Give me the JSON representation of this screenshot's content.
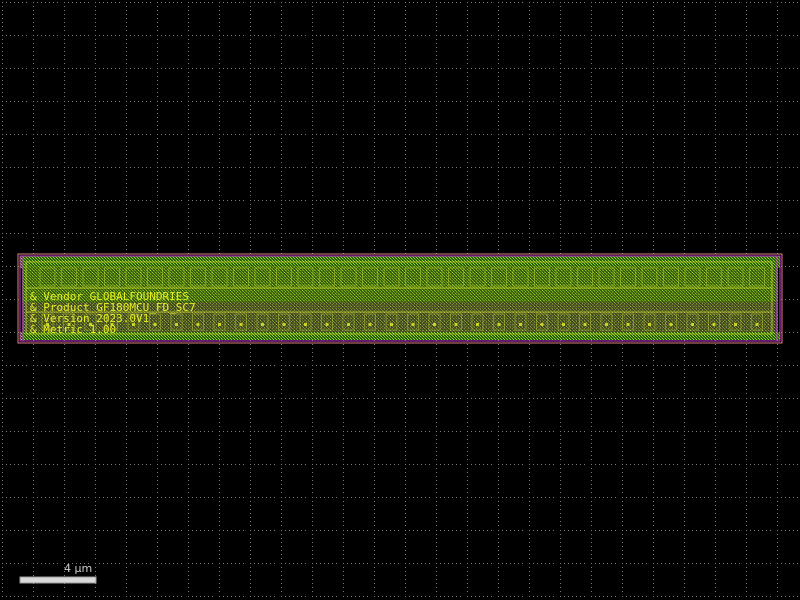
{
  "viewer": {
    "layout_labels": [
      "& Vendor GLOBALFOUNDRIES",
      "& Product GF180MCU_FD_SC7",
      "& Version 2023.0V1",
      "& Metric 1.00"
    ],
    "scale_bar": {
      "label": "4 µm"
    }
  },
  "colors": {
    "background": "#000000",
    "grid_dot": "#7a7a7a",
    "diffusion_green": "#6fd91b",
    "metal_yellow": "#d8e030",
    "boundary_magenta": "#c23ad6",
    "well_pink": "#e08080",
    "text_yellow": "#e8f020",
    "scale_gray": "#cfcfcf"
  }
}
